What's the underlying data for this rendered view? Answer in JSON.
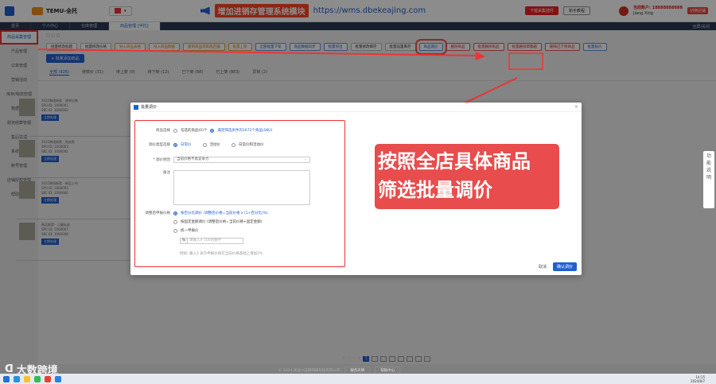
{
  "topbar": {
    "brand": "TEMU-全托",
    "banner_warn": "增加进销存管理系统模块",
    "banner_url": "https://wms.dbekeajing.com",
    "download_btn": "下载采集插件",
    "tutorial_btn": "新手教程",
    "user_line1": "当前账户: 18888888888",
    "user_line2": "Jiang Xing",
    "user_tag": "切换店铺"
  },
  "tabs": [
    "首页",
    "个人中心",
    "仓库管理",
    "商品管理 [半托]"
  ],
  "tab_right": "全屏/关闭",
  "sidebar": [
    "商品采集管理",
    "产品管理",
    "订单管理",
    "营销活动",
    "库存/物流管理",
    "数据统计",
    "财务结算管理",
    "售后管理",
    "系统设置",
    "账号管理",
    "店铺授权管理",
    "帮助中心"
  ],
  "main": {
    "primary_btn": "+ 批量添加商品",
    "toolbar_buttons": [
      {
        "label": "批量修改标题",
        "style": ""
      },
      {
        "label": "批量修改价格",
        "style": ""
      },
      {
        "label": "导入商品表格",
        "style": "orange"
      },
      {
        "label": "导入商品数据",
        "style": "orange"
      },
      {
        "label": "复制商品到其他店铺",
        "style": "orange"
      },
      {
        "label": "批量上架",
        "style": "orange"
      },
      {
        "label": "全部批量下架",
        "style": "blue"
      },
      {
        "label": "商品数据同步",
        "style": "blue"
      },
      {
        "label": "批量导出",
        "style": "blue"
      },
      {
        "label": "批量修改库存",
        "style": ""
      },
      {
        "label": "批量设置库存",
        "style": ""
      },
      {
        "label": "商品调价",
        "style": "blue price"
      },
      {
        "label": "删除商品",
        "style": "red"
      },
      {
        "label": "批量删除商品",
        "style": "red"
      },
      {
        "label": "批量删除草稿箱",
        "style": "red"
      },
      {
        "label": "删除已下架商品",
        "style": "red"
      },
      {
        "label": "批量核价",
        "style": "blue"
      }
    ],
    "status_tabs": [
      "全部 (926)",
      "待核价 (31)",
      "待上架 (0)",
      "待下架 (12)",
      "已下架 (88)",
      "已上架 (883)",
      "异常 (2)"
    ],
    "products": [
      {
        "title": "2022跨境新款 · 原单出售",
        "meta": "SPU ID: 1000001",
        "sku": "SKC ID: 1000002",
        "btn": "立即处理"
      },
      {
        "title": "2022跨境新款 · 热卖款",
        "meta": "SPU ID: 1000003",
        "sku": "SKC ID: 1000004",
        "btn": "立即处理"
      },
      {
        "title": "2022跨境新款 · 新品上市",
        "meta": "SPU ID: 1000005",
        "sku": "SKC ID: 1000006",
        "btn": "立即处理"
      },
      {
        "title": "新品推荐 · 儿童玩具",
        "meta": "SPU ID: 1000007",
        "sku": "SKC ID: 1000008",
        "btn": "立即处理"
      }
    ]
  },
  "dialog": {
    "title": "批量调价",
    "scope_label": "商品选择",
    "scope_opt1": "勾选的商品(0)个",
    "scope_opt2": "满足筛选条件的1672个商品(SKU)",
    "type_label": "调价类型选择",
    "type_opt1": "日常价",
    "type_opt2": "活动价",
    "type_opt3": "日常价和活动价",
    "reason_label": "* 调价原因",
    "reason_value": "当前价格不具竞争力",
    "note_label": "备注",
    "rule_label": "调整后申报价格",
    "rule_opt1": "按百分比调价 (调整后价格=当前价格 x (1+百分比)%)",
    "rule_opt2": "按固定金额调价 (调整后价格=当前价格+固定金额)",
    "rule_opt3": "统一申报价",
    "pct_unit": "%",
    "pct_placeholder": "请输入0-100的数字",
    "note_text": "例如: 输入5 表示申报价格在当前价格基础上增加5%",
    "cancel": "取消",
    "ok": "确认调价"
  },
  "callout": {
    "line1": "按照全店具体商品",
    "line2": "筛选批量调价"
  },
  "right_float": [
    "功",
    "能",
    "说",
    "明"
  ],
  "pager": [
    "1",
    "2",
    "3",
    "4",
    "5",
    "6",
    "...",
    "158"
  ],
  "pager_total": "共 1672 条",
  "footer": {
    "copyright": "© 2024 商业小蓝鲸网络科技有限公司",
    "btn1": "服务声明",
    "btn2": "帮助中心"
  },
  "watermark": "大数跨境",
  "clock": {
    "time": "14:15",
    "date": "2024/8/7"
  }
}
